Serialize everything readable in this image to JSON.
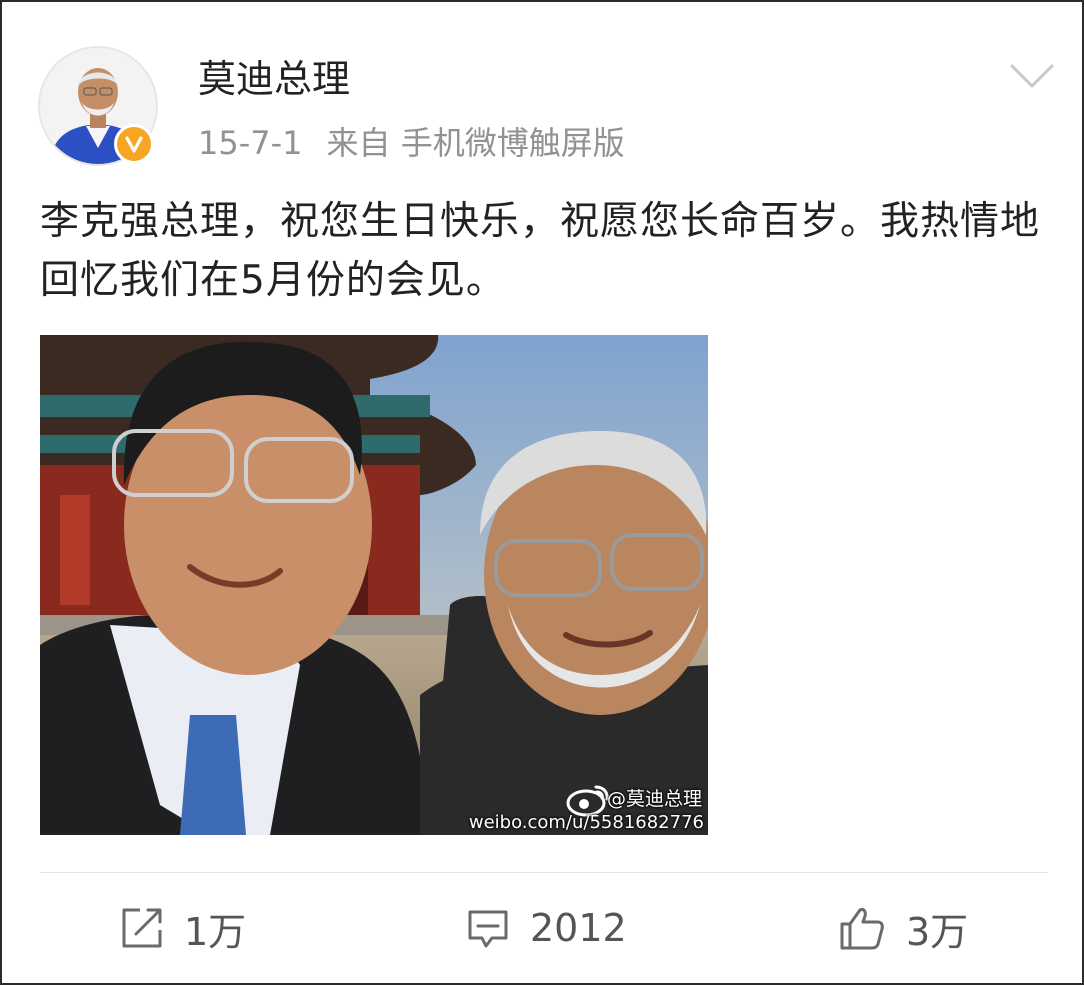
{
  "post": {
    "author": "莫迪总理",
    "date": "15-7-1",
    "source": "来自 手机微博触屏版",
    "text": "李克强总理，祝您生日快乐，祝愿您长命百岁。我热情地回忆我们在5月份的会见。",
    "image": {
      "watermark_handle": "@莫迪总理",
      "watermark_url": "weibo.com/u/5581682776"
    }
  },
  "actions": {
    "repost_count": "1万",
    "comment_count": "2012",
    "like_count": "3万"
  },
  "colors": {
    "verified_badge": "#f6a623",
    "meta_text": "#929292"
  },
  "icons": [
    "verified-v-icon",
    "chevron-down-icon",
    "repost-icon",
    "comment-icon",
    "like-icon",
    "weibo-logo-icon"
  ]
}
